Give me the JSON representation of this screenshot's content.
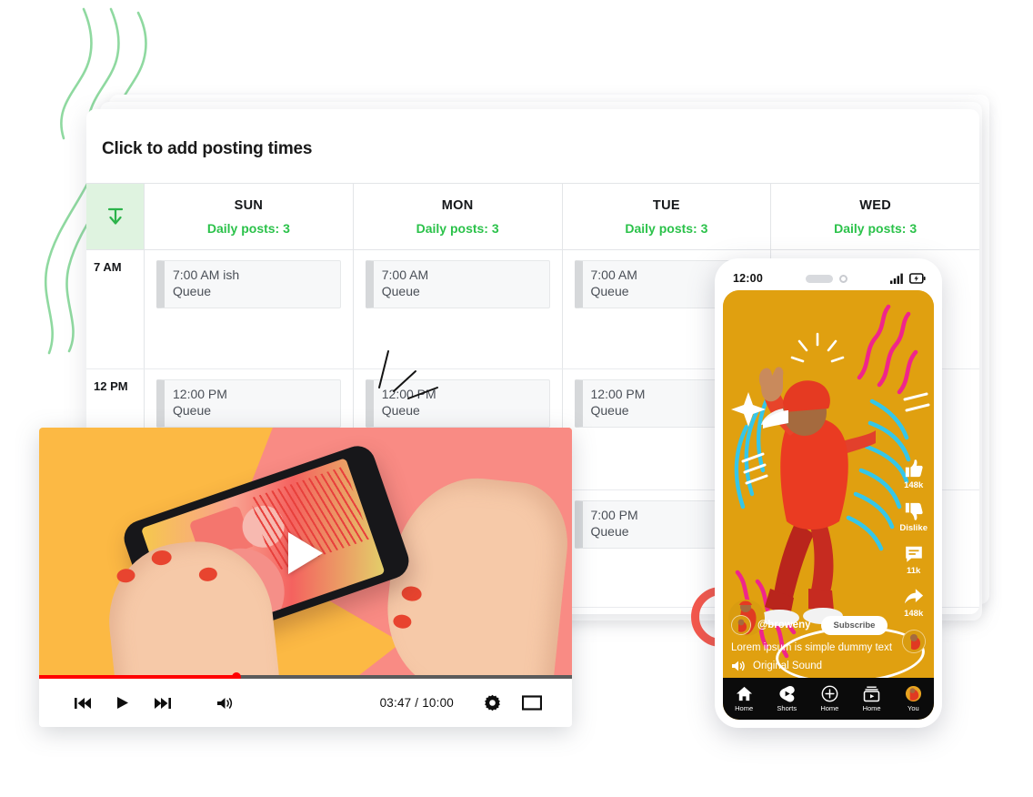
{
  "scheduler": {
    "title": "Click to add posting times",
    "download_icon": "download-arrow-icon",
    "columns": [
      {
        "day": "SUN",
        "posts_label": "Daily posts: 3"
      },
      {
        "day": "MON",
        "posts_label": "Daily posts: 3"
      },
      {
        "day": "TUE",
        "posts_label": "Daily posts: 3"
      },
      {
        "day": "WED",
        "posts_label": "Daily posts: 3"
      }
    ],
    "rows": [
      {
        "time_label": "7 AM",
        "cells": [
          {
            "time": "7:00 AM ish",
            "status": "Queue"
          },
          {
            "time": "7:00 AM",
            "status": "Queue"
          },
          {
            "time": "7:00 AM",
            "status": "Queue"
          },
          {
            "time": "",
            "status": ""
          }
        ]
      },
      {
        "time_label": "12 PM",
        "cells": [
          {
            "time": "12:00 PM",
            "status": "Queue"
          },
          {
            "time": "12:00 PM",
            "status": "Queue"
          },
          {
            "time": "12:00 PM",
            "status": "Queue"
          },
          {
            "time": "",
            "status": ""
          }
        ]
      },
      {
        "time_label": "",
        "cells": [
          {
            "time": "",
            "status": ""
          },
          {
            "time": "",
            "status": ""
          },
          {
            "time": "7:00 PM",
            "status": "Queue"
          },
          {
            "time": "",
            "status": ""
          }
        ]
      }
    ],
    "accent_green": "#2bc24a",
    "corner_bg": "#dff3e0"
  },
  "video_player": {
    "play_icon": "play-triangle-icon",
    "current_time": "03:47",
    "duration": "10:00",
    "time_display": "03:47 / 10:00",
    "progress_percent": 37,
    "controls": [
      {
        "name": "previous-icon",
        "label": "Previous"
      },
      {
        "name": "play-icon",
        "label": "Play"
      },
      {
        "name": "next-icon",
        "label": "Next"
      },
      {
        "name": "volume-icon",
        "label": "Volume"
      }
    ],
    "settings_icon": "gear-icon",
    "fullscreen_icon": "fullscreen-icon",
    "progress_color": "#ff0000"
  },
  "shorts_phone": {
    "status_bar": {
      "time": "12:00",
      "signal_icon": "signal-bars-icon",
      "battery_icon": "battery-charging-icon",
      "speaker_icon": "speaker-pill-icon",
      "camera_icon": "front-camera-icon"
    },
    "background_color": "#e0a010",
    "actions": [
      {
        "icon": "thumbs-up-icon",
        "label": "148k"
      },
      {
        "icon": "thumbs-down-icon",
        "label": "Dislike"
      },
      {
        "icon": "comment-icon",
        "label": "11k"
      },
      {
        "icon": "share-icon",
        "label": "148k"
      }
    ],
    "avatar_icon": "channel-avatar-icon",
    "handle": "@broweny",
    "subscribe_label": "Subscribe",
    "caption": "Lorem ipsum is simple dummy text",
    "sound_icon": "sound-icon",
    "sound_label": "Original Sound",
    "nav": [
      {
        "icon": "home-icon",
        "label": "Home"
      },
      {
        "icon": "shorts-icon",
        "label": "Shorts"
      },
      {
        "icon": "plus-circle-icon",
        "label": "Home"
      },
      {
        "icon": "subscriptions-icon",
        "label": "Home"
      },
      {
        "icon": "account-icon",
        "label": "You"
      }
    ]
  },
  "decorations": {
    "squiggle_color": "#8fd9a0",
    "red_ring_color": "#f4574c"
  }
}
